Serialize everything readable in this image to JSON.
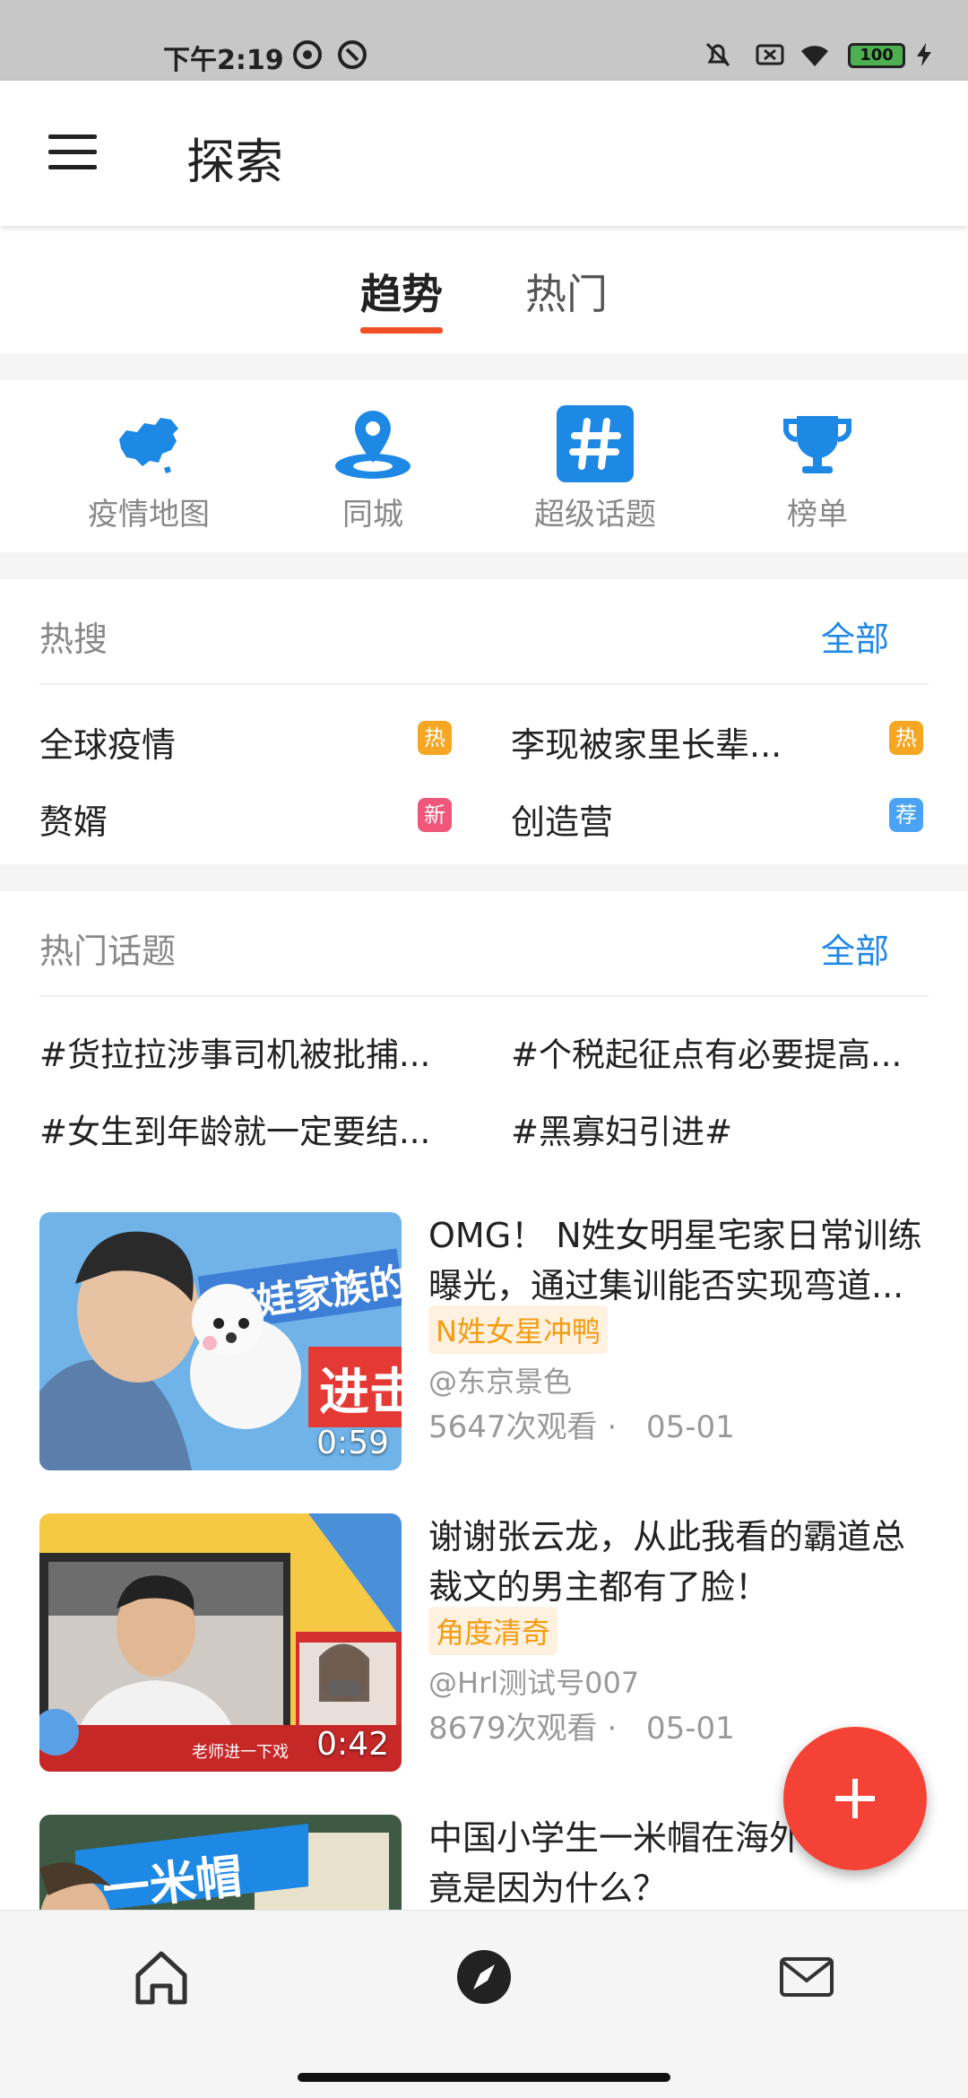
{
  "status": {
    "time": "下午2:19",
    "battery": "100"
  },
  "app_bar": {
    "title": "探索"
  },
  "tabs": [
    {
      "label": "趋势"
    },
    {
      "label": "热门"
    }
  ],
  "quick": [
    {
      "label": "疫情地图",
      "icon": "china-map-icon"
    },
    {
      "label": "同城",
      "icon": "location-pin-icon"
    },
    {
      "label": "超级话题",
      "icon": "hashtag-icon"
    },
    {
      "label": "榜单",
      "icon": "trophy-icon"
    }
  ],
  "hot_search": {
    "title": "热搜",
    "all": "全部",
    "items": [
      {
        "text": "全球疫情",
        "badge": "热",
        "badge_color": "#f5a623"
      },
      {
        "text": "李现被家里长辈...",
        "badge": "热",
        "badge_color": "#f5a623"
      },
      {
        "text": "赘婿",
        "badge": "新",
        "badge_color": "#f0577a"
      },
      {
        "text": "创造营",
        "badge": "荐",
        "badge_color": "#4aa3f5"
      }
    ]
  },
  "hot_topics": {
    "title": "热门话题",
    "all": "全部",
    "items": [
      "#货拉拉涉事司机被批捕...",
      "#个税起征点有必要提高...",
      "#女生到年龄就一定要结...",
      "#黑寡妇引进#"
    ]
  },
  "feed": [
    {
      "title": "OMG！ N姓女明星宅家日常训练曝光，通过集训能否实现弯道...",
      "tag": "N姓女星冲鸭",
      "author": "@东京景色",
      "views": "5647次观看 ·",
      "date": "05-01",
      "duration": "0:59"
    },
    {
      "title": "谢谢张云龙，从此我看的霸道总裁文的男主都有了脸！",
      "tag": "角度清奇",
      "author": "@Hrl测试号007",
      "views": "8679次观看 ·",
      "date": "05-01",
      "duration": "0:42"
    },
    {
      "title": "中国小学生一米帽在海外了，究竟是因为什么？",
      "tag": "",
      "author": "",
      "views": "",
      "date": "",
      "duration": ""
    }
  ],
  "thumb_texts": {
    "t1_banner": "奈娃家族的",
    "t1_red": "进击",
    "t2_caption": "老师进一下戏",
    "t3_banner": "一米帽"
  },
  "colors": {
    "accent": "#f04e23",
    "link": "#1e88e5",
    "fab": "#f44336"
  }
}
